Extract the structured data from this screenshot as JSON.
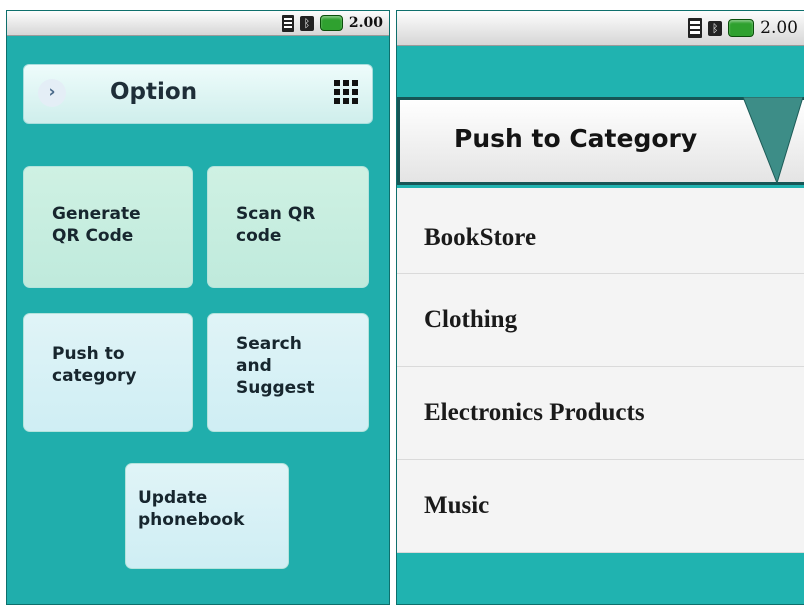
{
  "status_bar": {
    "time": "2.00",
    "icons": [
      "signal-icon",
      "bluetooth-icon",
      "battery-icon"
    ],
    "bluetooth_glyph": "ᛒ"
  },
  "option_screen": {
    "title": "Option",
    "back_glyph": "›",
    "tiles": [
      {
        "label": "Generate\nQR Code"
      },
      {
        "label": "Scan QR\ncode"
      },
      {
        "label": "Push to\ncategory"
      },
      {
        "label": "Search\nand\nSuggest"
      },
      {
        "label": "Update\nphonebook"
      }
    ]
  },
  "category_screen": {
    "title": "Push to Category",
    "items": [
      {
        "label": "BookStore"
      },
      {
        "label": "Clothing"
      },
      {
        "label": "Electronics Products"
      },
      {
        "label": "Music"
      }
    ]
  },
  "colors": {
    "teal_background": "#20aeac",
    "tile_mint": "#cff1e3",
    "tile_sky": "#e0f4f7",
    "header_border": "#165656",
    "arrow_teal": "#3d8d87",
    "battery_green": "#2fa12f"
  }
}
